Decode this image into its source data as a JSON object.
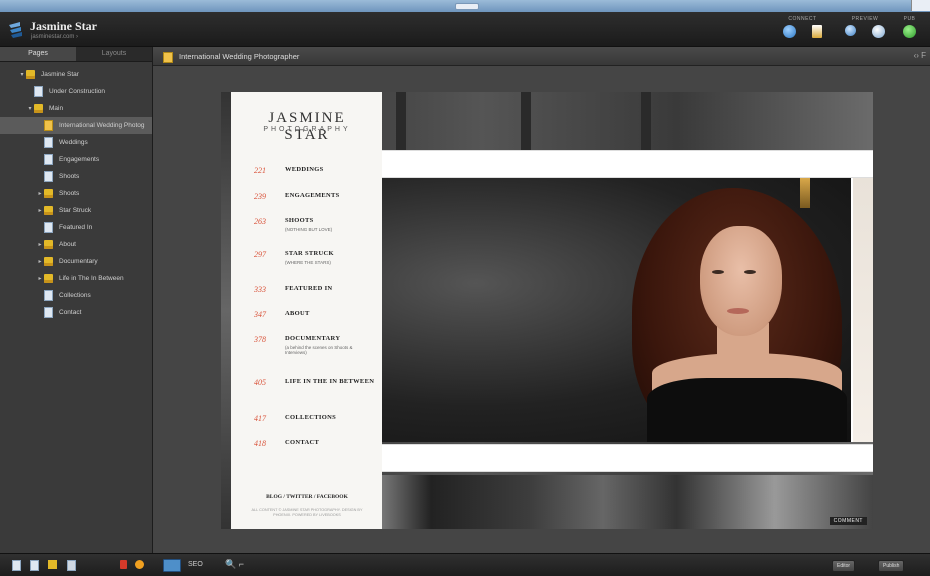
{
  "header": {
    "title": "Jasmine Star",
    "subtitle": "jasminestar.com ›",
    "groups": [
      {
        "label": "CONNECT",
        "icons": [
          "connect-globe-icon",
          "publish-page-icon"
        ]
      },
      {
        "label": "PREVIEW",
        "icons": [
          "preview-magnifier-icon",
          "preview-browser-icon"
        ]
      },
      {
        "label": "PUB",
        "icons": [
          "publish-icon"
        ]
      }
    ]
  },
  "sidebar": {
    "tabs": [
      "Pages",
      "Layouts"
    ],
    "tree": [
      {
        "label": "Jasmine Star",
        "type": "folder",
        "depth": 0,
        "expanded": true
      },
      {
        "label": "Under Construction",
        "type": "page",
        "depth": 1
      },
      {
        "label": "Main",
        "type": "folder",
        "depth": 1,
        "expanded": true
      },
      {
        "label": "International Wedding Photog",
        "type": "page",
        "depth": 2,
        "selected": true
      },
      {
        "label": "Weddings",
        "type": "page",
        "depth": 2
      },
      {
        "label": "Engagements",
        "type": "page",
        "depth": 2
      },
      {
        "label": "Shoots",
        "type": "page",
        "depth": 2
      },
      {
        "label": "Shoots",
        "type": "folder",
        "depth": 2
      },
      {
        "label": "Star Struck",
        "type": "folder",
        "depth": 2
      },
      {
        "label": "Featured In",
        "type": "page",
        "depth": 2
      },
      {
        "label": "About",
        "type": "folder",
        "depth": 2
      },
      {
        "label": "Documentary",
        "type": "folder",
        "depth": 2
      },
      {
        "label": "Life in The In Between",
        "type": "folder",
        "depth": 2
      },
      {
        "label": "Collections",
        "type": "page",
        "depth": 2
      },
      {
        "label": "Contact",
        "type": "page",
        "depth": 2
      }
    ]
  },
  "page_header": {
    "title": "International Wedding Photographer",
    "right": "‹› F"
  },
  "preview": {
    "brand_line1": "JASMINE STAR",
    "brand_line2": "PHOTOGRAPHY",
    "menu": [
      {
        "num": "221",
        "label": "WEDDINGS",
        "sub": ""
      },
      {
        "num": "239",
        "label": "ENGAGEMENTS",
        "sub": ""
      },
      {
        "num": "263",
        "label": "SHOOTS",
        "sub": "(NOTHING BUT LOVE)"
      },
      {
        "num": "297",
        "label": "STAR STRUCK",
        "sub": "(WHERE THE STARS)"
      },
      {
        "num": "333",
        "label": "FEATURED IN",
        "sub": ""
      },
      {
        "num": "347",
        "label": "ABOUT",
        "sub": ""
      },
      {
        "num": "378",
        "label": "DOCUMENTARY",
        "sub": "(a behind the scenes on Shoots & Interviews)"
      },
      {
        "num": "405",
        "label": "LIFE IN THE IN BETWEEN",
        "sub": ""
      },
      {
        "num": "417",
        "label": "COLLECTIONS",
        "sub": ""
      },
      {
        "num": "418",
        "label": "CONTACT",
        "sub": ""
      }
    ],
    "footer_links": "BLOG / TWITTER / FACEBOOK",
    "copyright": "ALL CONTENT © JASMINE STAR PHOTOGRAPHY. DESIGN BY PHOENIX. POWERED BY LIVEBOOKS",
    "comment": "COMMENT"
  },
  "bottom": {
    "seo": "SEO",
    "zoom": "🔍 ⌐",
    "btn_editor": "Editor",
    "btn_publish": "Publish"
  }
}
